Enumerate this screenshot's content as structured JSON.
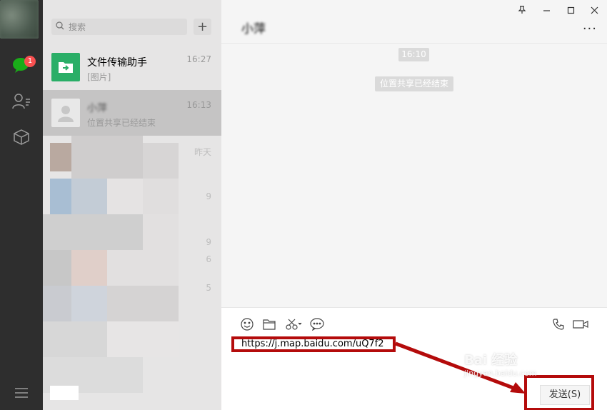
{
  "nav": {
    "badge_count": "1",
    "icons": [
      "chat-icon",
      "contacts-icon",
      "favorites-icon",
      "menu-icon"
    ],
    "colors": {
      "chat_active": "#1aad19",
      "badge": "#fa5151",
      "background": "#2e2e2e"
    }
  },
  "search": {
    "placeholder": "搜索",
    "add_label": "+"
  },
  "conversations": [
    {
      "name": "文件传输助手",
      "preview": "[图片]",
      "time": "16:27",
      "icon": "file-transfer-icon",
      "color": "#2aae67"
    },
    {
      "name": "小萍",
      "preview": "位置共享已经结束",
      "time": "16:13",
      "icon": "default-avatar-icon"
    },
    {
      "name": "",
      "preview": "",
      "time": "昨天"
    }
  ],
  "blurred_times": [
    "9",
    "9",
    "6",
    "5"
  ],
  "chat": {
    "title": "小萍",
    "window_controls": [
      "pin-icon",
      "minimize-icon",
      "maximize-icon",
      "close-icon"
    ],
    "more_label": "···",
    "time_stamp": "16:10",
    "system_message": "位置共享已经结束",
    "input_value": "https://j.map.baidu.com/uQ7f2",
    "send_label": "发送(S)"
  },
  "annotations": {
    "highlight_color": "#b40b0b"
  },
  "watermark": {
    "line1": "Bai 经验",
    "line2": "jingyan.baidu.com"
  }
}
